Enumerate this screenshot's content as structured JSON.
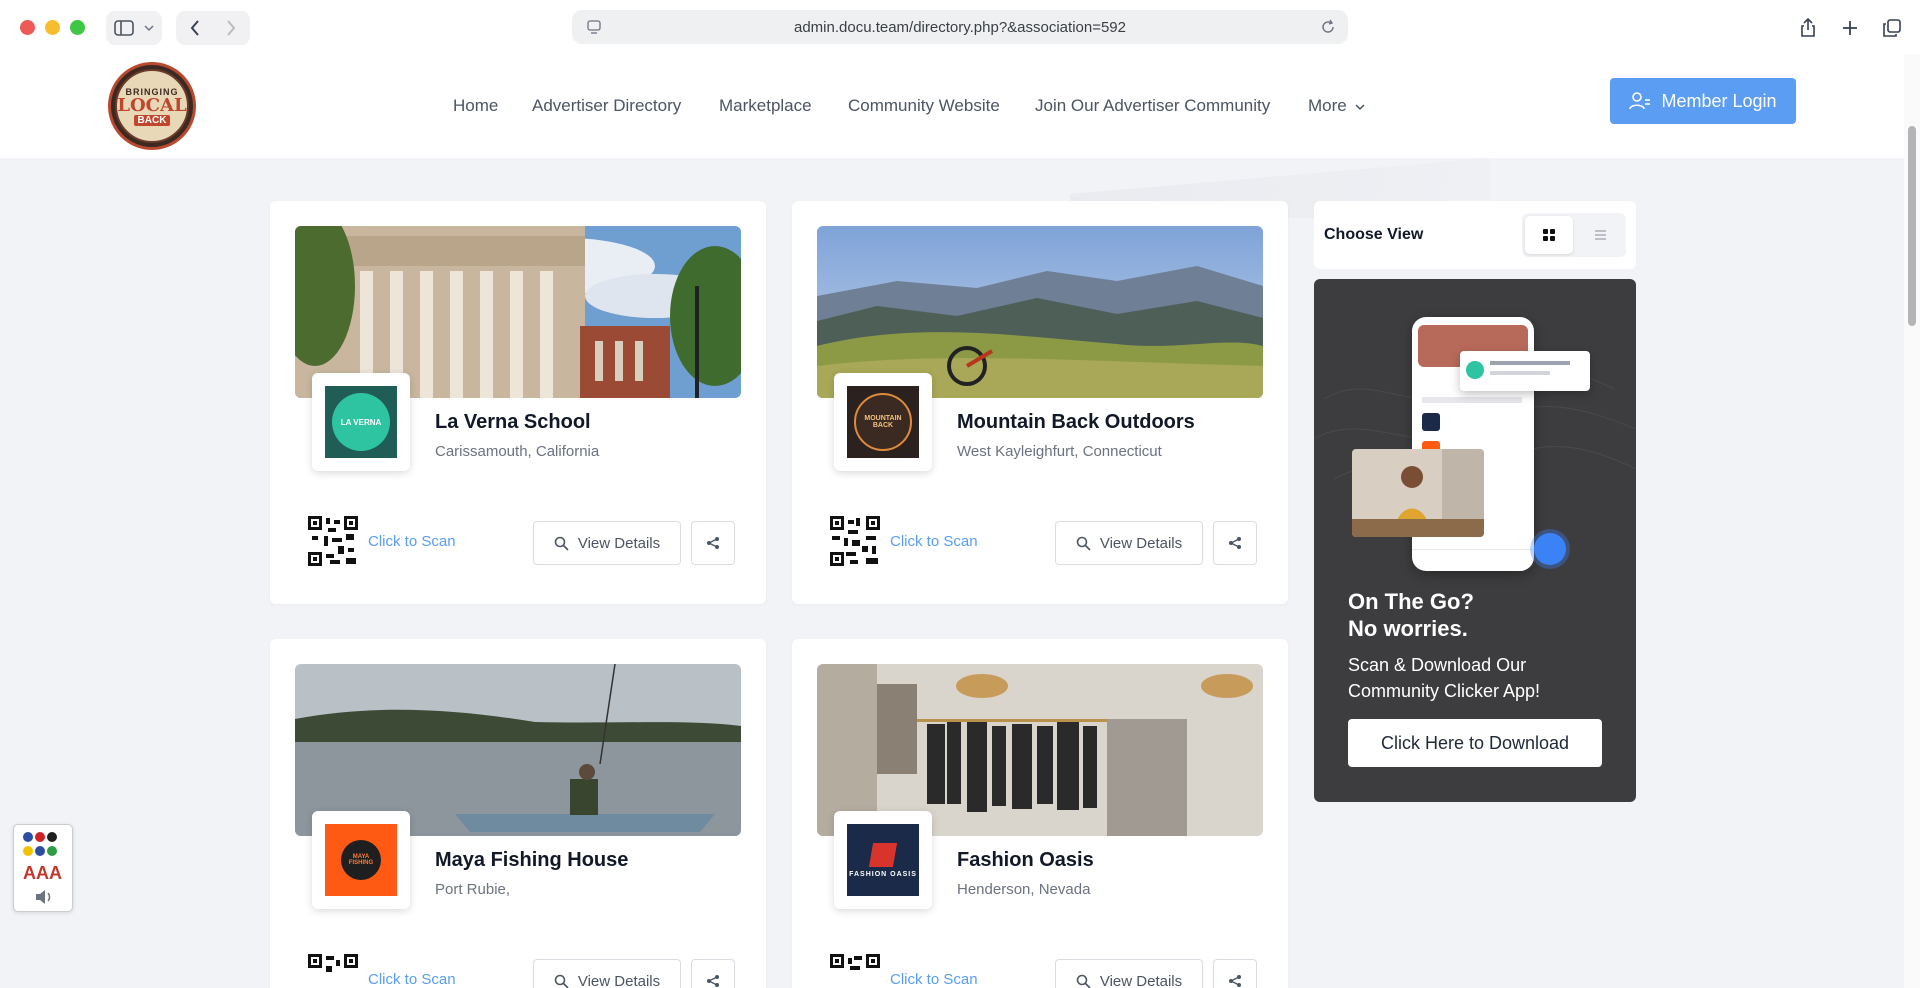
{
  "browser": {
    "url": "admin.docu.team/directory.php?&association=592",
    "icons": [
      "sidebar-icon",
      "chevron-down-icon",
      "back-icon",
      "forward-icon",
      "site-settings-icon",
      "reload-icon",
      "share-icon",
      "new-tab-icon",
      "tabs-overview-icon"
    ]
  },
  "header": {
    "logo": {
      "line1": "BRINGING",
      "line2": "LOCAL",
      "line3": "BACK"
    },
    "nav": [
      {
        "label": "Home"
      },
      {
        "label": "Advertiser Directory"
      },
      {
        "label": "Marketplace"
      },
      {
        "label": "Community Website"
      },
      {
        "label": "Join Our Advertiser Community"
      },
      {
        "label": "More"
      }
    ],
    "login_label": "Member Login"
  },
  "cards": [
    {
      "name": "La Verna School",
      "location": "Carissamouth, California",
      "logo_text": "LA VERNA",
      "logo_color": "#1f5d56",
      "scan_label": "Click to Scan",
      "details_label": "View Details"
    },
    {
      "name": "Mountain Back Outdoors",
      "location": "West Kayleighfurt, Connecticut",
      "logo_text": "MOUNTAIN BACK",
      "logo_color": "#2b2220",
      "scan_label": "Click to Scan",
      "details_label": "View Details"
    },
    {
      "name": "Maya Fishing House",
      "location": "Port Rubie,",
      "logo_text": "MAYA FISHING",
      "logo_color": "#ff5a14",
      "scan_label": "Click to Scan",
      "details_label": "View Details"
    },
    {
      "name": "Fashion Oasis",
      "location": "Henderson, Nevada",
      "logo_text": "FASHION OASIS",
      "logo_color": "#1c2a4a",
      "scan_label": "Click to Scan",
      "details_label": "View Details"
    }
  ],
  "sidebar": {
    "choose_view_label": "Choose View",
    "promo": {
      "title_line1": "On The Go?",
      "title_line2": "No worries.",
      "subtitle": "Scan & Download Our Community Clicker App!",
      "button_label": "Click Here to Download"
    }
  },
  "accessibility": {
    "font_size_label": "AAA"
  },
  "colors": {
    "accent": "#5a9df2",
    "promo_bg": "#3d3d3f",
    "page_bg": "#f2f3f6"
  }
}
